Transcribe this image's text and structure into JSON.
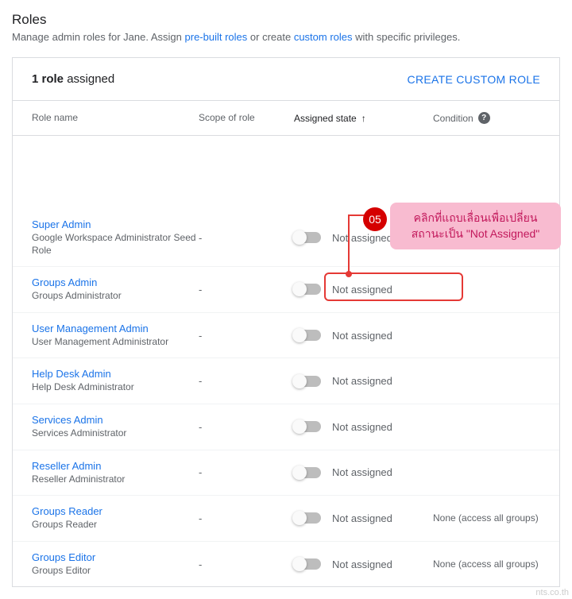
{
  "header": {
    "title": "Roles",
    "subtitle_pre": "Manage admin roles for Jane. Assign ",
    "link1": "pre-built roles",
    "subtitle_mid": " or create ",
    "link2": "custom roles",
    "subtitle_post": " with specific privileges."
  },
  "panel": {
    "count_num": "1 role",
    "count_text": " assigned",
    "create": "CREATE CUSTOM ROLE"
  },
  "columns": {
    "name": "Role name",
    "scope": "Scope of role",
    "state": "Assigned state",
    "arrow": "↑",
    "condition": "Condition",
    "help": "?"
  },
  "rows": [
    {
      "name": "Super Admin",
      "desc": "Google Workspace Administrator Seed Role",
      "scope": "-",
      "state": "Not assigned",
      "condition": ""
    },
    {
      "name": "Groups Admin",
      "desc": "Groups Administrator",
      "scope": "-",
      "state": "Not assigned",
      "condition": ""
    },
    {
      "name": "User Management Admin",
      "desc": "User Management Administrator",
      "scope": "-",
      "state": "Not assigned",
      "condition": ""
    },
    {
      "name": "Help Desk Admin",
      "desc": "Help Desk Administrator",
      "scope": "-",
      "state": "Not assigned",
      "condition": ""
    },
    {
      "name": "Services Admin",
      "desc": "Services Administrator",
      "scope": "-",
      "state": "Not assigned",
      "condition": ""
    },
    {
      "name": "Reseller Admin",
      "desc": "Reseller Administrator",
      "scope": "-",
      "state": "Not assigned",
      "condition": ""
    },
    {
      "name": "Groups Reader",
      "desc": "Groups Reader",
      "scope": "-",
      "state": "Not assigned",
      "condition": "None (access all groups)"
    },
    {
      "name": "Groups Editor",
      "desc": "Groups Editor",
      "scope": "-",
      "state": "Not assigned",
      "condition": "None (access all groups)"
    }
  ],
  "callout": {
    "num": "05",
    "line1": "คลิกที่แถบเลื่อนเพื่อเปลี่ยน",
    "line2": "สถานะเป็น \"Not Assigned\""
  },
  "watermark": "nts.co.th"
}
